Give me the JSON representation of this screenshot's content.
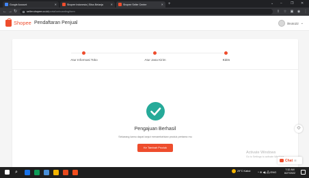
{
  "browser": {
    "tabs": [
      {
        "title": "Google Account",
        "favicon_color": "#4285f4",
        "active": false
      },
      {
        "title": "Shopee Indonesia | Situs Belanja",
        "favicon_color": "#ee4d2d",
        "active": false
      },
      {
        "title": "Shopee Seller Centre",
        "favicon_color": "#ee4d2d",
        "active": true
      }
    ],
    "new_tab_label": "+",
    "window_controls": {
      "minimize": "−",
      "restore": "❐",
      "close": "✕",
      "dropdown": "⌄"
    },
    "url_host": "seller.shopee.co.id",
    "url_path": "/portal/onboarding/form"
  },
  "header": {
    "brand": "Shopee",
    "title": "Pendaftaran Penjual",
    "username": "ilmoto22"
  },
  "steps": [
    {
      "label": "Atur Informasi Toko",
      "done": true
    },
    {
      "label": "Atur Jasa Kirim",
      "done": true
    },
    {
      "label": "Kirim",
      "done": true
    }
  ],
  "success": {
    "title": "Pengajuan Berhasil",
    "description": "Sekarang kamu dapat lanjut menambahkan produk pertama mu",
    "button_label": "Ke Tambah Produk"
  },
  "chat": {
    "label": "Chat",
    "menu": "☰"
  },
  "watermark": {
    "line1": "Activate Windows",
    "line2": "Go to Settings to activate Windows."
  },
  "taskbar": {
    "weather": "29°C Kabut",
    "tray": "^ ⊕ ◀) 🖧 ENG",
    "time": "7:32 AM",
    "date": "6/27/2022"
  },
  "colors": {
    "brand": "#ee4d2d",
    "success": "#26aa99"
  }
}
